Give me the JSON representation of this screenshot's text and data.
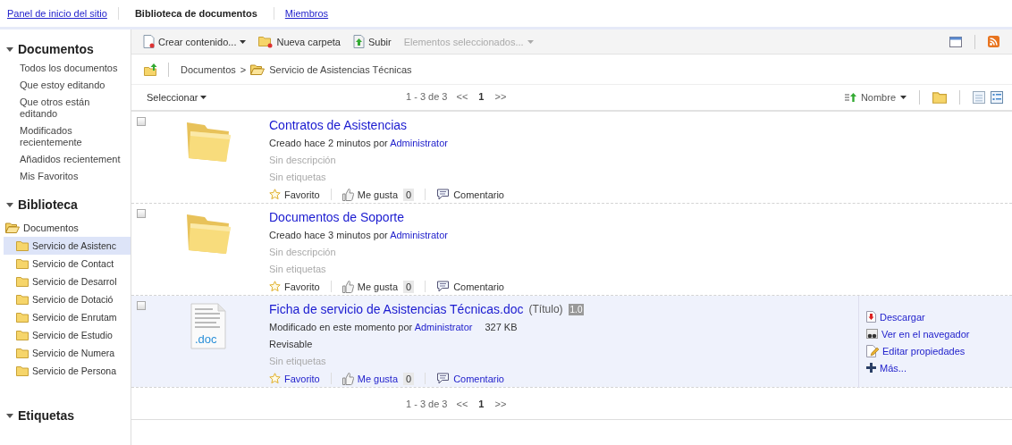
{
  "nav": {
    "tabs": [
      {
        "label": "Panel de inicio del sitio",
        "selected": false
      },
      {
        "label": "Biblioteca de documentos",
        "selected": true
      },
      {
        "label": "Miembros",
        "selected": false
      }
    ]
  },
  "sidebar": {
    "sections": [
      {
        "title": "Documentos",
        "kind": "links",
        "items": [
          {
            "label": "Todos los documentos"
          },
          {
            "label": "Que estoy editando"
          },
          {
            "label": "Que otros están editando"
          },
          {
            "label": "Modificados recientemente"
          },
          {
            "label": "Añadidos recientement"
          },
          {
            "label": "Mis Favoritos"
          }
        ]
      },
      {
        "title": "Biblioteca",
        "kind": "tree",
        "tree": [
          {
            "label": "Documentos",
            "selected": false,
            "children": [
              {
                "label": "Servicio de Asistenc",
                "selected": true
              },
              {
                "label": "Servicio de Contact",
                "selected": false
              },
              {
                "label": "Servicio de Desarrol",
                "selected": false
              },
              {
                "label": "Servicio de Dotació",
                "selected": false
              },
              {
                "label": "Servicio de Enrutam",
                "selected": false
              },
              {
                "label": "Servicio de Estudio",
                "selected": false
              },
              {
                "label": "Servicio de Numera",
                "selected": false
              },
              {
                "label": "Servicio de Persona",
                "selected": false
              }
            ]
          }
        ]
      },
      {
        "title": "Etiquetas",
        "kind": "links"
      }
    ]
  },
  "toolbar": {
    "buttons": [
      {
        "label": "Crear contenido...",
        "kind": "create",
        "menu": true,
        "disabled": false
      },
      {
        "label": "Nueva carpeta",
        "kind": "folder",
        "menu": false,
        "disabled": false
      },
      {
        "label": "Subir",
        "kind": "upload",
        "menu": false,
        "disabled": false
      },
      {
        "label": "Elementos seleccionados...",
        "kind": "selection",
        "menu": true,
        "disabled": true
      }
    ]
  },
  "breadcrumb": {
    "path": [
      "Documentos",
      "Servicio de Asistencias Técnicas"
    ],
    "separator": ">"
  },
  "list_header": {
    "select_label": "Seleccionar",
    "sort_label": "Nombre",
    "pager": {
      "range": "1 - 3 de 3",
      "prev": "<<",
      "page": "1",
      "next": ">>"
    }
  },
  "rows": [
    {
      "kind": "folder",
      "selected": false,
      "checked": false,
      "title": "Contratos de Asistencias",
      "meta": "Creado hace 2 minutos por",
      "author": "Administrator",
      "description": "Sin descripción",
      "description_empty": true,
      "tags": "Sin etiquetas",
      "favorite": "Favorito",
      "like": "Me gusta",
      "like_count": "0",
      "comment": "Comentario"
    },
    {
      "kind": "folder",
      "selected": false,
      "checked": false,
      "title": "Documentos de Soporte",
      "meta": "Creado hace 3 minutos por",
      "author": "Administrator",
      "description": "Sin descripción",
      "description_empty": true,
      "tags": "Sin etiquetas",
      "favorite": "Favorito",
      "like": "Me gusta",
      "like_count": "0",
      "comment": "Comentario"
    },
    {
      "kind": "document",
      "selected": true,
      "checked": false,
      "file_type": ".doc",
      "title": "Ficha de servicio de Asistencias Técnicas.doc",
      "title_note": "(Título)",
      "version": "1.0",
      "meta": "Modificado en este momento por",
      "author": "Administrator",
      "size": "327 KB",
      "description": "Revisable",
      "description_empty": false,
      "tags": "Sin etiquetas",
      "favorite": "Favorito",
      "like": "Me gusta",
      "like_count": "0",
      "comment": "Comentario",
      "actions": [
        {
          "label": "Descargar",
          "kind": "download"
        },
        {
          "label": "Ver en el navegador",
          "kind": "view"
        },
        {
          "label": "Editar propiedades",
          "kind": "edit"
        },
        {
          "label": "Más...",
          "kind": "more"
        }
      ]
    }
  ],
  "footer_pager": {
    "range": "1 - 3 de 3",
    "prev": "<<",
    "page": "1",
    "next": ">>"
  }
}
